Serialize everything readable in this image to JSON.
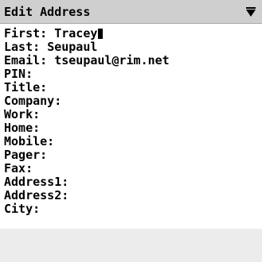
{
  "title_bar": {
    "title": "Edit Address",
    "dropdown_icon": "down-triangle-icon"
  },
  "form": {
    "fields": [
      {
        "label": "First:",
        "value": "Tracey"
      },
      {
        "label": "Last:",
        "value": "Seupaul"
      },
      {
        "label": "Email:",
        "value": "tseupaul@rim.net"
      },
      {
        "label": "PIN:",
        "value": ""
      },
      {
        "label": "Title:",
        "value": ""
      },
      {
        "label": "Company:",
        "value": ""
      },
      {
        "label": "Work:",
        "value": ""
      },
      {
        "label": "Home:",
        "value": ""
      },
      {
        "label": "Mobile:",
        "value": ""
      },
      {
        "label": "Pager:",
        "value": ""
      },
      {
        "label": "Fax:",
        "value": ""
      },
      {
        "label": "Address1:",
        "value": ""
      },
      {
        "label": "Address2:",
        "value": ""
      },
      {
        "label": "City:",
        "value": ""
      }
    ]
  },
  "colors": {
    "background": "#ffffff",
    "title_bar": "#cfcfcf",
    "bottom_strip": "#ececec",
    "text": "#000000"
  }
}
